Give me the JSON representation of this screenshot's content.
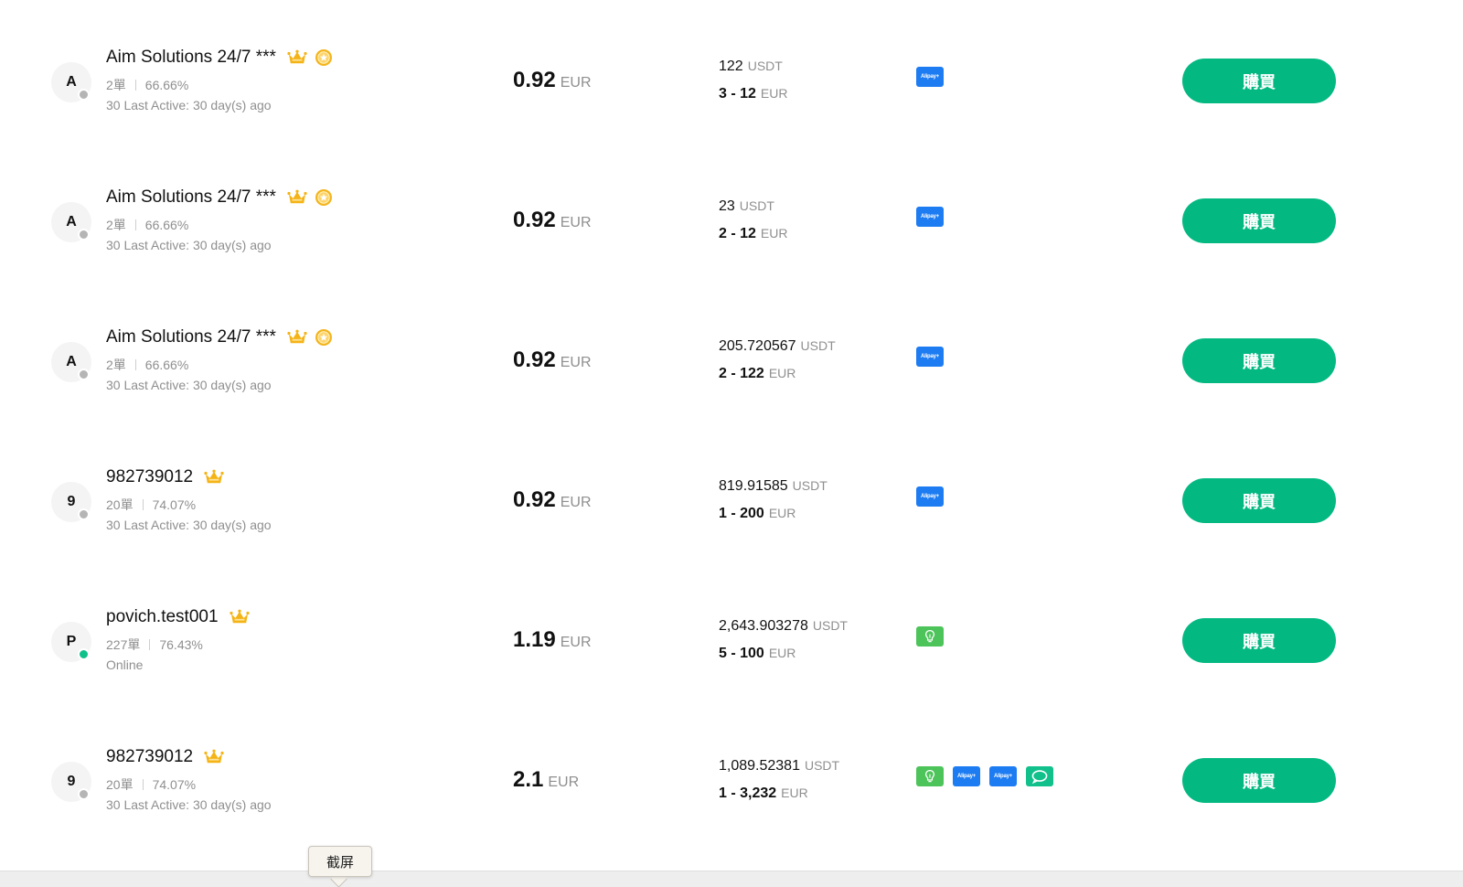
{
  "listings": [
    {
      "avatar_letter": "A",
      "name": "Aim Solutions 24/7 ***",
      "orders": "2單",
      "completion": "66.66%",
      "activity": "30 Last Active: 30 day(s) ago",
      "online": false,
      "badges": [
        "crown-icon",
        "medal-icon"
      ],
      "price": "0.92",
      "price_unit": "EUR",
      "amount": "122",
      "amount_unit": "USDT",
      "limit": "3 - 12",
      "limit_unit": "EUR",
      "payments": [
        {
          "type": "alipay",
          "label": "Alipay+"
        }
      ],
      "button_label": "購買"
    },
    {
      "avatar_letter": "A",
      "name": "Aim Solutions 24/7 ***",
      "orders": "2單",
      "completion": "66.66%",
      "activity": "30 Last Active: 30 day(s) ago",
      "online": false,
      "badges": [
        "crown-icon",
        "medal-icon"
      ],
      "price": "0.92",
      "price_unit": "EUR",
      "amount": "23",
      "amount_unit": "USDT",
      "limit": "2 - 12",
      "limit_unit": "EUR",
      "payments": [
        {
          "type": "alipay",
          "label": "Alipay+"
        }
      ],
      "button_label": "購買"
    },
    {
      "avatar_letter": "A",
      "name": "Aim Solutions 24/7 ***",
      "orders": "2單",
      "completion": "66.66%",
      "activity": "30 Last Active: 30 day(s) ago",
      "online": false,
      "badges": [
        "crown-icon",
        "medal-icon"
      ],
      "price": "0.92",
      "price_unit": "EUR",
      "amount": "205.720567",
      "amount_unit": "USDT",
      "limit": "2 - 122",
      "limit_unit": "EUR",
      "payments": [
        {
          "type": "alipay",
          "label": "Alipay+"
        }
      ],
      "button_label": "購買"
    },
    {
      "avatar_letter": "9",
      "name": "982739012",
      "orders": "20單",
      "completion": "74.07%",
      "activity": "30 Last Active: 30 day(s) ago",
      "online": false,
      "badges": [
        "crown-icon"
      ],
      "price": "0.92",
      "price_unit": "EUR",
      "amount": "819.91585",
      "amount_unit": "USDT",
      "limit": "1 - 200",
      "limit_unit": "EUR",
      "payments": [
        {
          "type": "alipay",
          "label": "Alipay+"
        }
      ],
      "button_label": "購買"
    },
    {
      "avatar_letter": "P",
      "name": "povich.test001",
      "orders": "227單",
      "completion": "76.43%",
      "activity": "Online",
      "online": true,
      "badges": [
        "crown-icon"
      ],
      "price": "1.19",
      "price_unit": "EUR",
      "amount": "2,643.903278",
      "amount_unit": "USDT",
      "limit": "5 - 100",
      "limit_unit": "EUR",
      "payments": [
        {
          "type": "bulb"
        }
      ],
      "button_label": "購買"
    },
    {
      "avatar_letter": "9",
      "name": "982739012",
      "orders": "20單",
      "completion": "74.07%",
      "activity": "30 Last Active: 30 day(s) ago",
      "online": false,
      "badges": [
        "crown-icon"
      ],
      "price": "2.1",
      "price_unit": "EUR",
      "amount": "1,089.52381",
      "amount_unit": "USDT",
      "limit": "1 - 3,232",
      "limit_unit": "EUR",
      "payments": [
        {
          "type": "bulb"
        },
        {
          "type": "alipay",
          "label": "Alipay+"
        },
        {
          "type": "alipay",
          "label": "Alipay+"
        },
        {
          "type": "chat"
        }
      ],
      "button_label": "購買"
    }
  ],
  "tooltip": {
    "label": "截屏"
  },
  "colors": {
    "buy_button": "#03b981",
    "online_dot": "#10c08a",
    "offline_dot": "#b5b5b5",
    "crown": "#f5b416",
    "alipay": "#1d7cf2",
    "bulb": "#4cc45a",
    "chat": "#12c08c"
  }
}
